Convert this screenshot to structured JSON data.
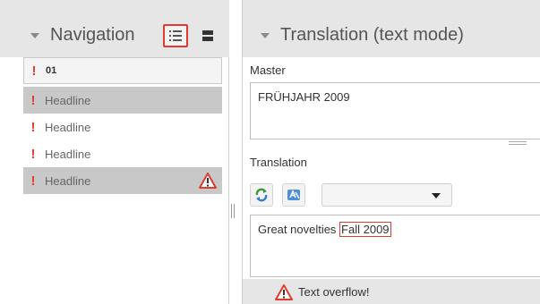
{
  "navigation": {
    "title": "Navigation",
    "list_view_icon": "list-view-icon",
    "block_view_icon": "block-view-icon",
    "group_label": "01",
    "items": [
      {
        "label": "Headline",
        "marker": "!",
        "state": "selected",
        "warning": false
      },
      {
        "label": "Headline",
        "marker": "!",
        "state": "normal",
        "warning": false
      },
      {
        "label": "Headline",
        "marker": "!",
        "state": "normal",
        "warning": false
      },
      {
        "label": "Headline",
        "marker": "!",
        "state": "selected",
        "warning": true
      }
    ]
  },
  "translation_panel": {
    "title": "Translation (text mode)",
    "master_label": "Master",
    "master_text": "FRÜHJAHR 2009",
    "translation_label": "Translation",
    "refresh_icon": "refresh-icon",
    "translate_icon": "translate-icon",
    "language_select_value": "",
    "translation_text_fit": "Great novelties ",
    "translation_text_overflow": "Fall 2009",
    "status_message": "Text overflow!"
  },
  "colors": {
    "accent_red": "#e03b2f",
    "header_gray": "#e6e6e6",
    "selected_row": "#c8c8c8"
  }
}
